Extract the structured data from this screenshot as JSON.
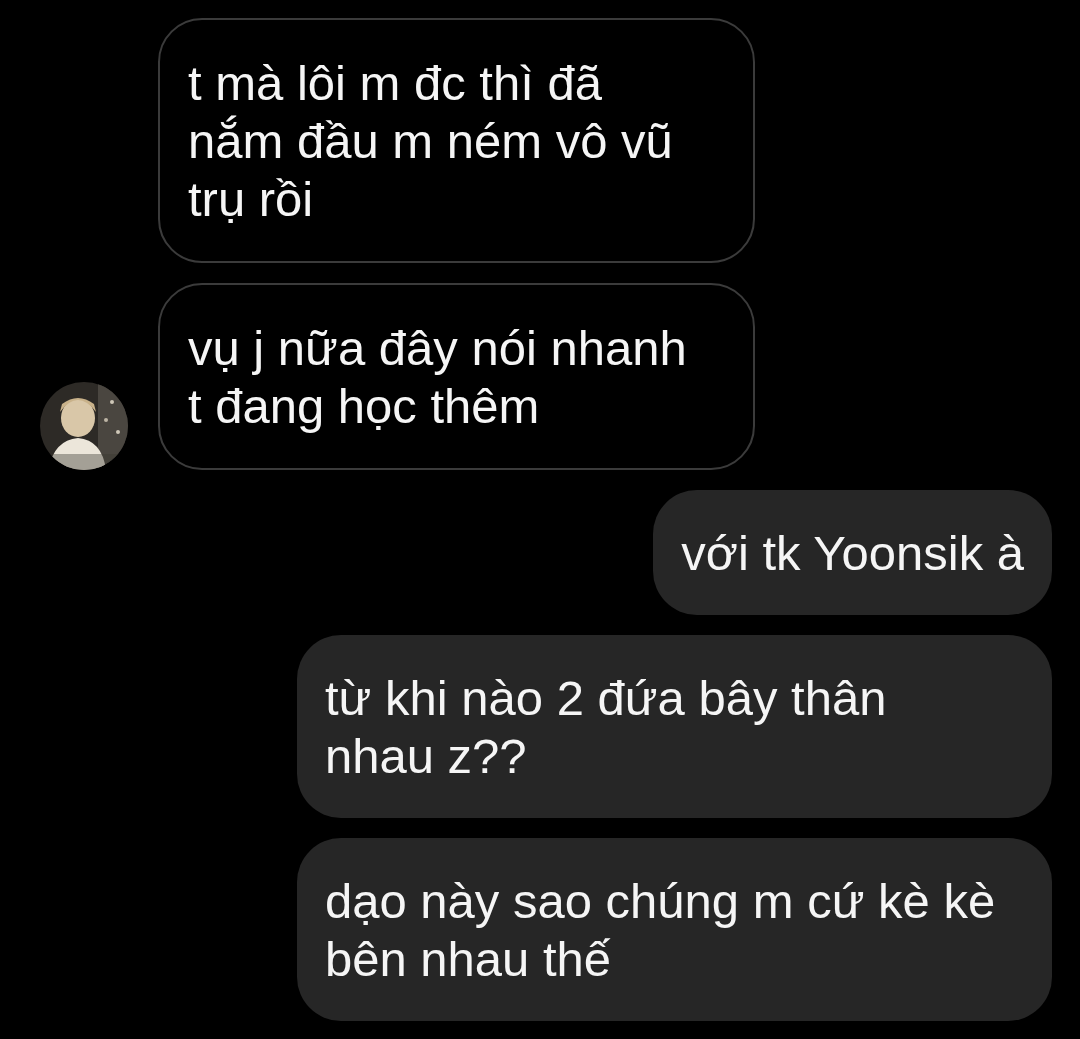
{
  "messages": [
    {
      "kind": "received",
      "lines": [
        "t mà lôi m đc thì đã",
        "nắm đầu m ném vô vũ",
        "trụ rồi"
      ],
      "avatar": false
    },
    {
      "kind": "received",
      "lines": [
        "vụ j nữa đây nói nhanh",
        "t đang học thêm"
      ],
      "avatar": true
    },
    {
      "kind": "sent",
      "lines": [
        "với tk Yoonsik à"
      ]
    },
    {
      "kind": "sent",
      "lines": [
        "từ khi nào 2 đứa bây thân",
        "nhau z??"
      ]
    },
    {
      "kind": "sent",
      "lines": [
        "dạo này sao chúng m cứ kè kè",
        "bên nhau thế"
      ]
    }
  ]
}
